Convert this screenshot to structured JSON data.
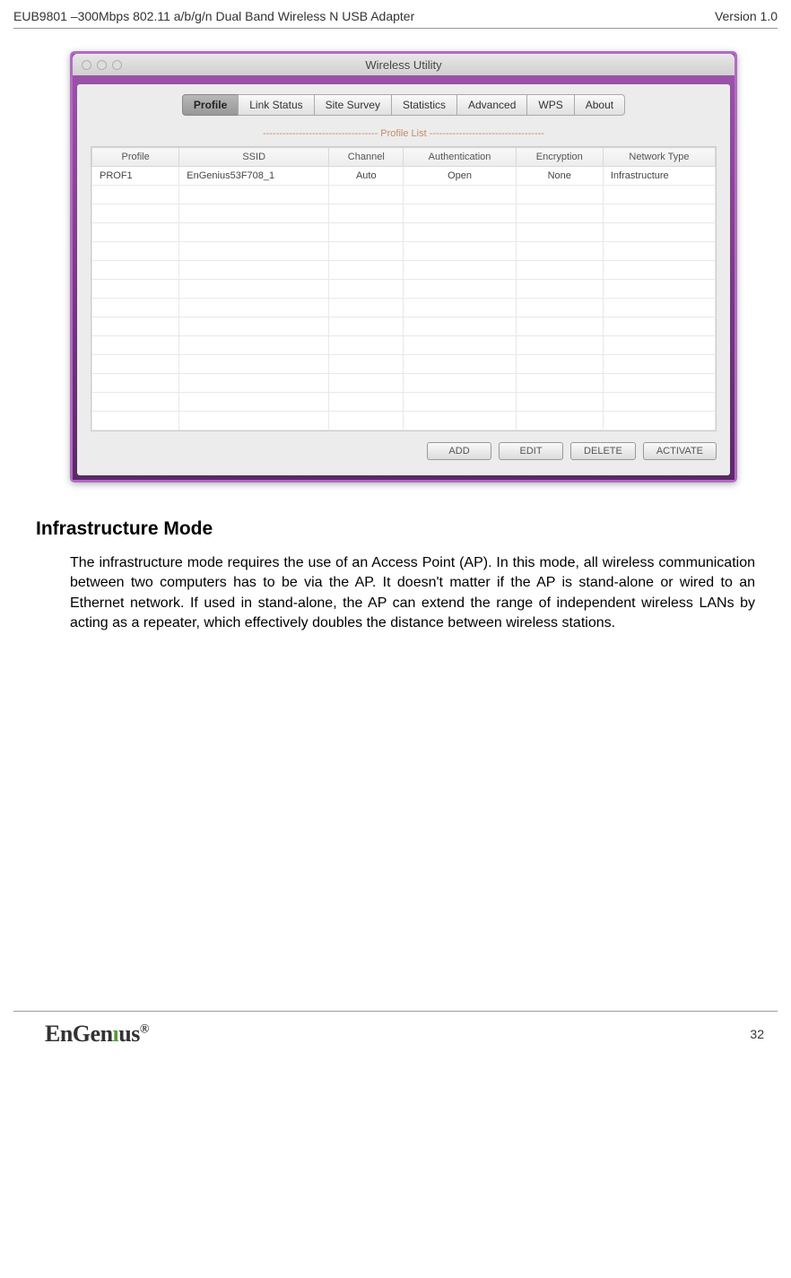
{
  "header": {
    "left": "EUB9801 –300Mbps 802.11 a/b/g/n Dual Band Wireless N USB Adapter",
    "right": "Version 1.0"
  },
  "window": {
    "title": "Wireless Utility"
  },
  "tabs": [
    "Profile",
    "Link Status",
    "Site Survey",
    "Statistics",
    "Advanced",
    "WPS",
    "About"
  ],
  "section_label": "----------------------------------- Profile List -----------------------------------",
  "table": {
    "headers": [
      "Profile",
      "SSID",
      "Channel",
      "Authentication",
      "Encryption",
      "Network Type"
    ],
    "rows": [
      {
        "profile": "PROF1",
        "ssid": "EnGenius53F708_1",
        "channel": "Auto",
        "auth": "Open",
        "encryption": "None",
        "nettype": "Infrastructure"
      }
    ]
  },
  "buttons": {
    "add": "ADD",
    "edit": "EDIT",
    "delete": "DELETE",
    "activate": "ACTIVATE"
  },
  "section": {
    "heading": "Infrastructure Mode",
    "body": "The infrastructure mode requires the use of an Access Point (AP). In this mode, all wireless communication between two computers has to be via the AP. It doesn't matter if the AP is stand-alone or wired to an Ethernet network. If used in stand-alone, the AP can extend the range of independent wireless LANs by acting as a repeater, which effectively doubles the distance between wireless stations."
  },
  "footer": {
    "logo_main": "EnGen",
    "logo_accent": "ı",
    "logo_end": "us",
    "page": "32"
  }
}
